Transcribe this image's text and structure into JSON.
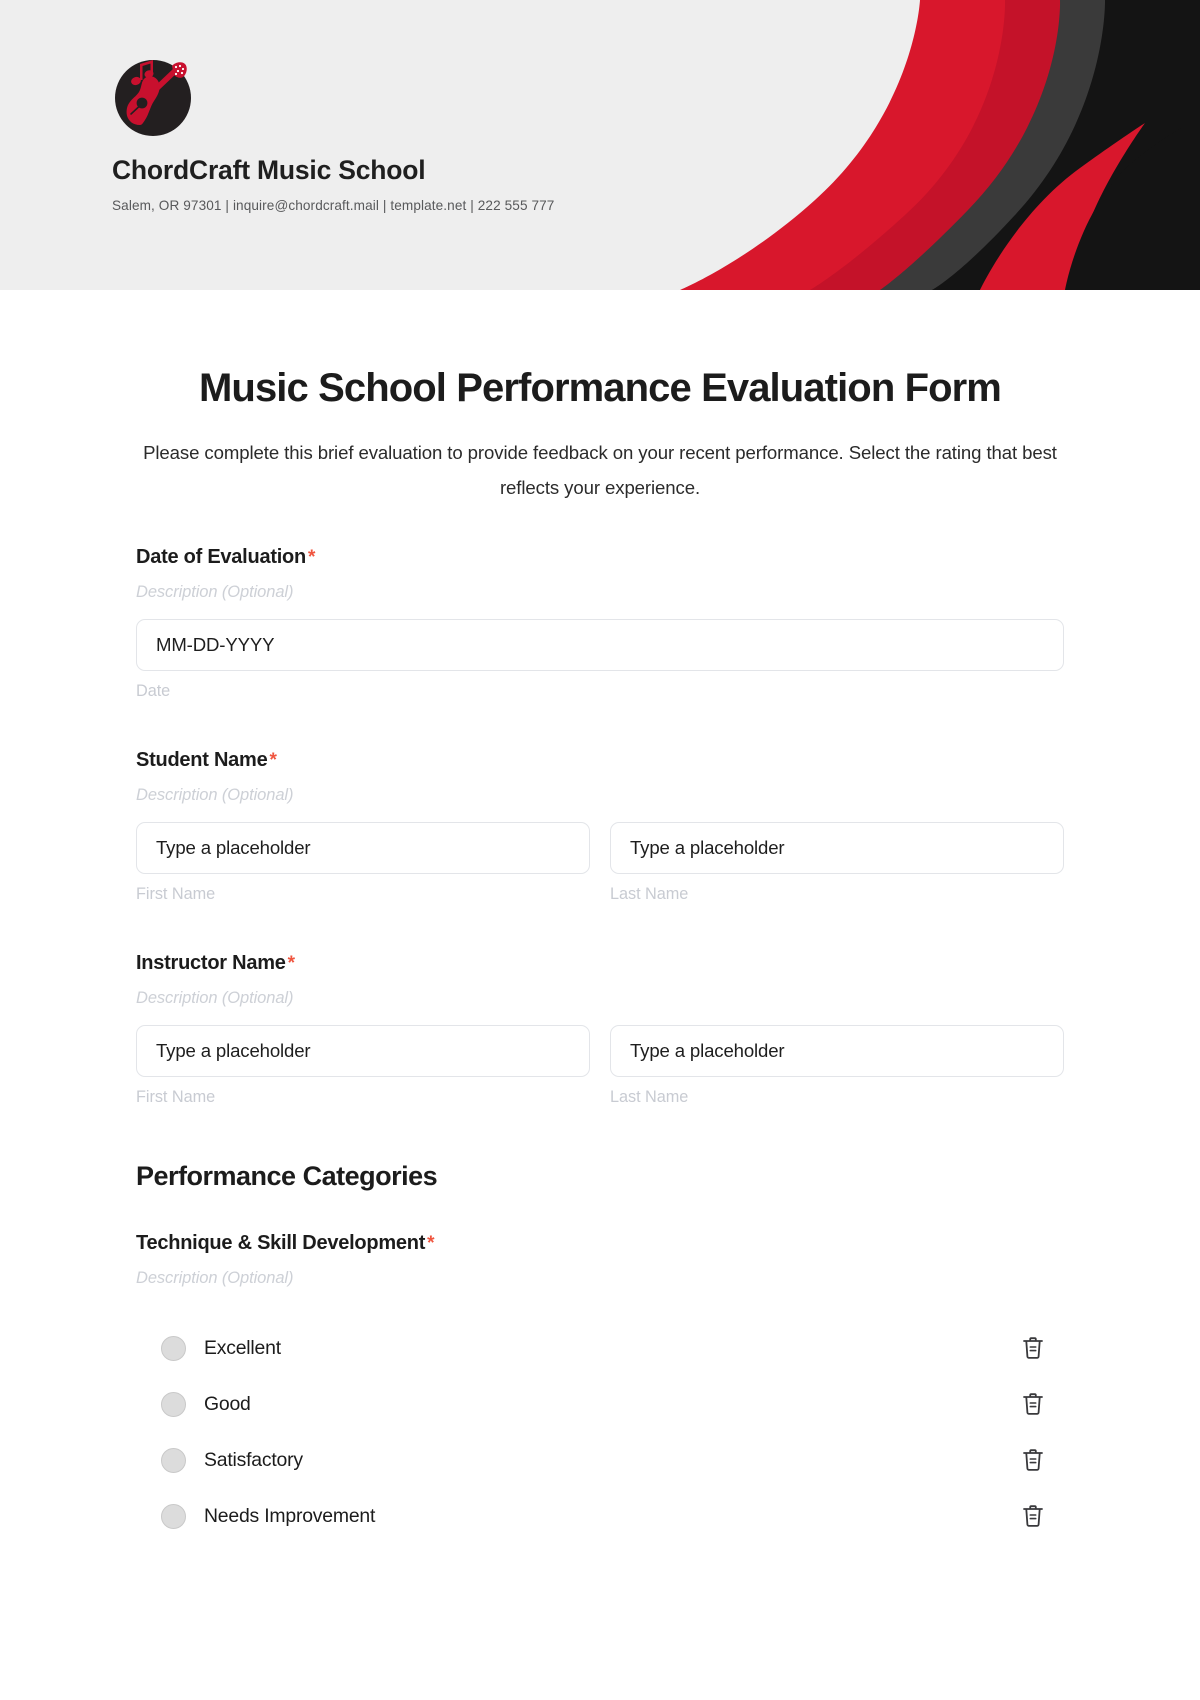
{
  "brand": {
    "name": "ChordCraft Music School",
    "contact": "Salem, OR 97301 | inquire@chordcraft.mail | template.net | 222 555 777",
    "logo_icon": "guitar-music-note-icon",
    "accent_red": "#d8172c",
    "accent_dark": "#1a1a1a",
    "banner_bg": "#eeeeee"
  },
  "form": {
    "title": "Music School Performance Evaluation Form",
    "subtitle_line1": "Please complete this brief evaluation to provide feedback on your recent performance.",
    "subtitle_line2": "Select the rating that best reflects your experience.",
    "required_marker": "*",
    "description_placeholder": "Description (Optional)"
  },
  "fields": [
    {
      "label": "Date of Evaluation",
      "required": true,
      "description": "Description (Optional)",
      "inputs": [
        {
          "placeholder": "MM-DD-YYYY",
          "value": "",
          "caption": "Date"
        }
      ]
    },
    {
      "label": "Student Name",
      "required": true,
      "description": "Description (Optional)",
      "inputs": [
        {
          "placeholder": "Type a placeholder",
          "value": "",
          "caption": "First Name"
        },
        {
          "placeholder": "Type a placeholder",
          "value": "",
          "caption": "Last Name"
        }
      ]
    },
    {
      "label": "Instructor Name",
      "required": true,
      "description": "Description (Optional)",
      "inputs": [
        {
          "placeholder": "Type a placeholder",
          "value": "",
          "caption": "First Name"
        },
        {
          "placeholder": "Type a placeholder",
          "value": "",
          "caption": "Last Name"
        }
      ]
    }
  ],
  "section": {
    "heading": "Performance Categories",
    "question": {
      "label": "Technique & Skill Development",
      "required": true,
      "description": "Description (Optional)",
      "options": [
        {
          "label": "Excellent",
          "selected": false,
          "delete_icon": "trash-icon"
        },
        {
          "label": "Good",
          "selected": false,
          "delete_icon": "trash-icon"
        },
        {
          "label": "Satisfactory",
          "selected": false,
          "delete_icon": "trash-icon"
        },
        {
          "label": "Needs Improvement",
          "selected": false,
          "delete_icon": "trash-icon"
        }
      ]
    }
  }
}
